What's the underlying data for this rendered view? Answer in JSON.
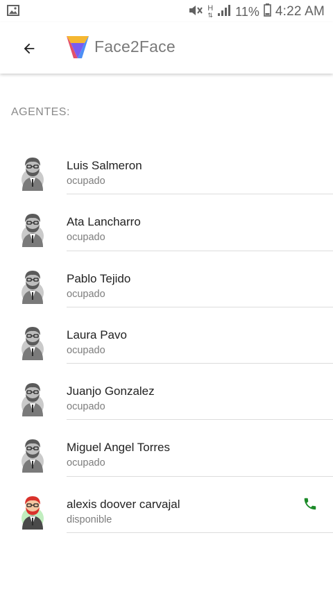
{
  "status_bar": {
    "battery": "11%",
    "time": "4:22 AM",
    "icons": [
      "image-icon",
      "mute-icon",
      "network-h-icon",
      "signal-icon",
      "battery-icon"
    ]
  },
  "app_bar": {
    "brand": "Face2Face",
    "back_icon": "arrow-back-icon",
    "logo_colors": [
      "#f5b731",
      "#e2506b",
      "#7a5cf0",
      "#4d8ff5"
    ]
  },
  "section": {
    "title": "AGENTES:"
  },
  "agents": [
    {
      "name": "Luis Salmeron",
      "status": "ocupado",
      "available": false
    },
    {
      "name": "Ata Lancharro",
      "status": "ocupado",
      "available": false
    },
    {
      "name": "Pablo Tejido",
      "status": "ocupado",
      "available": false
    },
    {
      "name": "Laura Pavo",
      "status": "ocupado",
      "available": false
    },
    {
      "name": "Juanjo Gonzalez",
      "status": "ocupado",
      "available": false
    },
    {
      "name": "Miguel Angel Torres",
      "status": "ocupado",
      "available": false
    },
    {
      "name": "alexis doover carvajal",
      "status": "disponible",
      "available": true
    }
  ],
  "colors": {
    "call_icon": "#1b8a28",
    "busy_avatar": "#7a7a7a",
    "available_avatar_hair": "#d9312b",
    "available_avatar_bg": "#8ee08a"
  }
}
